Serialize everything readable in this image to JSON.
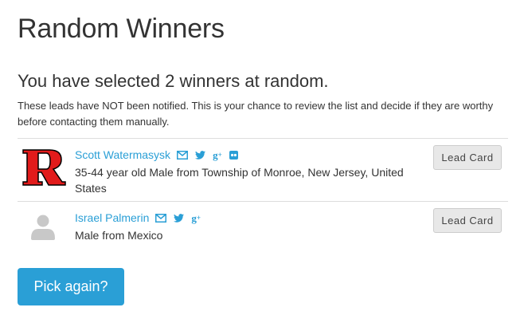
{
  "page": {
    "title": "Random Winners",
    "subtitle": "You have selected 2 winners at random.",
    "intro": "These leads have NOT been notified. This is your chance to review the list and decide if they are worthy before contacting them manually."
  },
  "winners": [
    {
      "name": "Scott Watermasysk",
      "detail": "35-44 year old Male from Township of Monroe, New Jersey, United States",
      "avatar": "rutgers-r-logo",
      "social_icons": [
        "email-icon",
        "twitter-icon",
        "google-plus-icon",
        "flickr-icon"
      ],
      "lead_card_label": "Lead Card"
    },
    {
      "name": "Israel Palmerin",
      "detail": "Male from Mexico",
      "avatar": "default-person-avatar",
      "social_icons": [
        "email-icon",
        "twitter-icon",
        "google-plus-icon"
      ],
      "lead_card_label": "Lead Card"
    }
  ],
  "actions": {
    "pick_again_label": "Pick again?"
  },
  "colors": {
    "accent": "#2a9fd6",
    "logo_red": "#e21b1b",
    "divider": "#dddddd",
    "button_gray": "#e8e8e8"
  }
}
